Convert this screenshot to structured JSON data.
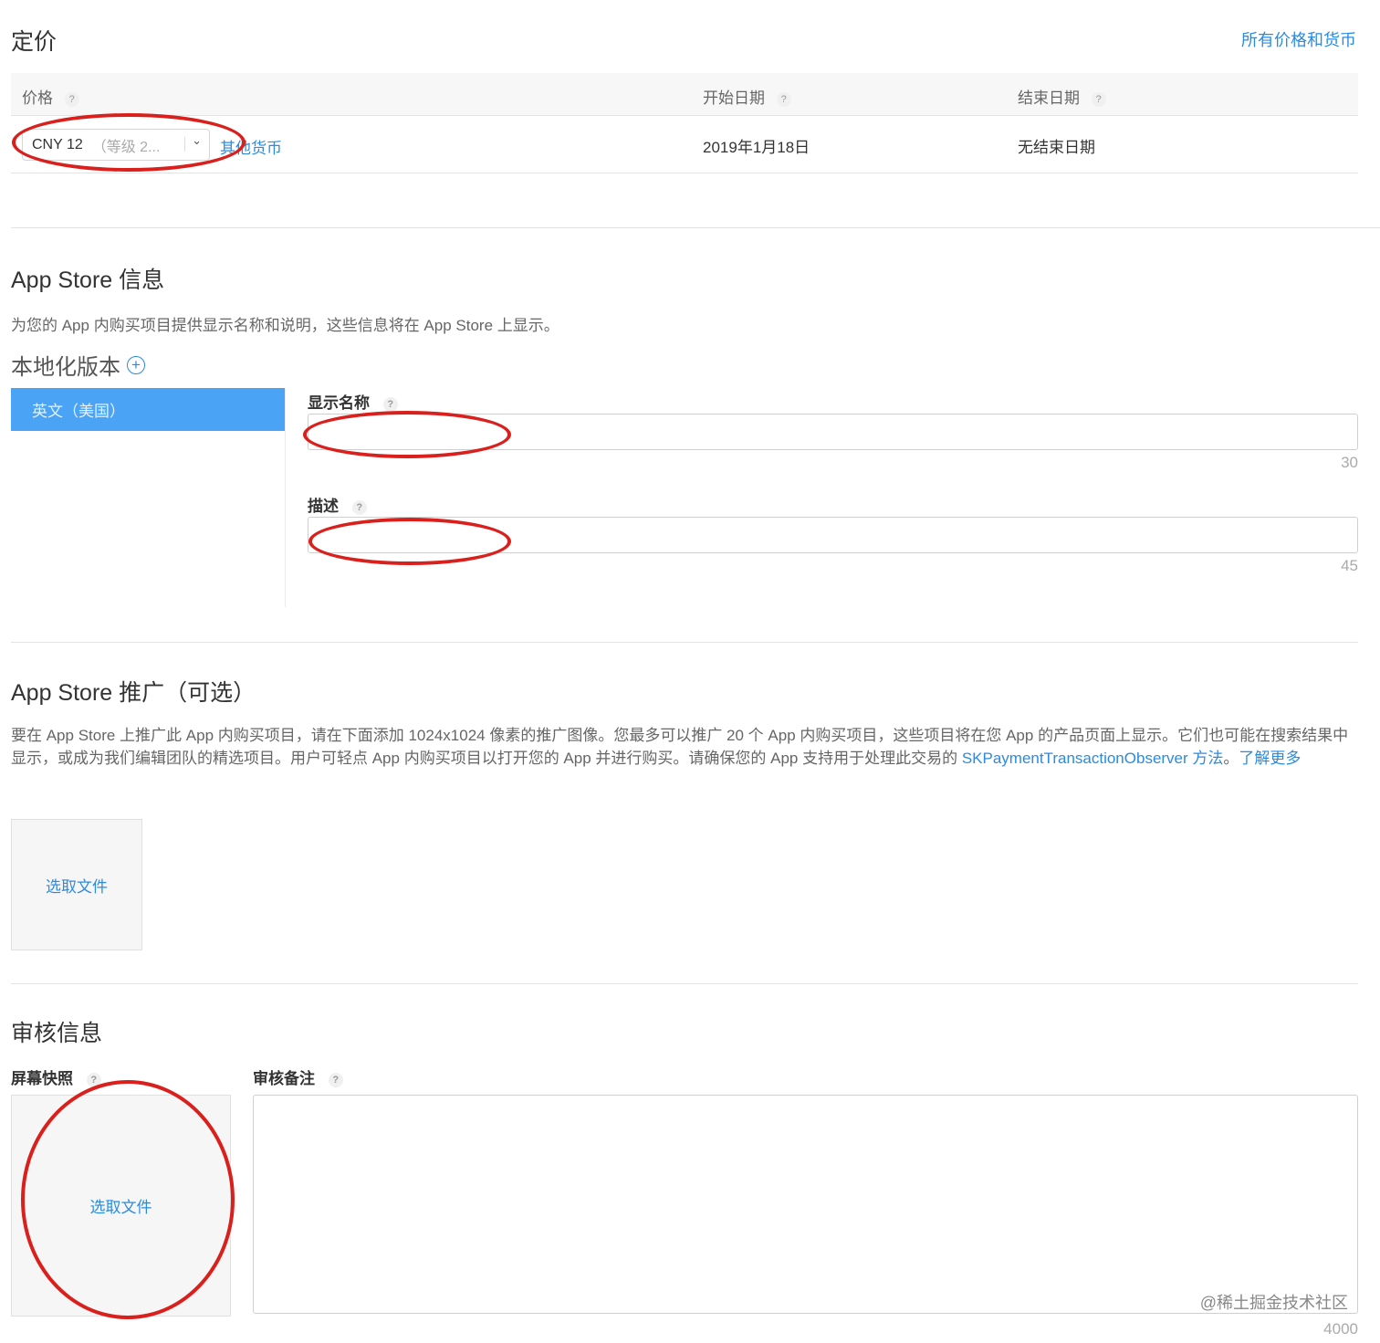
{
  "pricing": {
    "title": "定价",
    "all_prices_link": "所有价格和货币",
    "columns": {
      "price": "价格",
      "start_date": "开始日期",
      "end_date": "结束日期"
    },
    "help_mark": "?",
    "row": {
      "currency_value": "CNY 12",
      "tier_text": "（等级 2...",
      "other_currency_link": "其他货币",
      "start_date": "2019年1月18日",
      "end_date": "无结束日期"
    }
  },
  "store_info": {
    "title": "App Store 信息",
    "description": "为您的 App 内购买项目提供显示名称和说明，这些信息将在 App Store 上显示。",
    "localization_title": "本地化版本",
    "localizations": [
      "英文（美国）"
    ],
    "display_name_label": "显示名称",
    "display_name_value": "",
    "display_name_limit": "30",
    "description_label": "描述",
    "description_value": "",
    "description_limit": "45"
  },
  "promotion": {
    "title": "App Store 推广（可选）",
    "text_before": "要在 App Store 上推广此 App 内购买项目，请在下面添加 1024x1024 像素的推广图像。您最多可以推广 20 个 App 内购买项目，这些项目将在您 App 的产品页面上显示。它们也可能在搜索结果中显示，或成为我们编辑团队的精选项目。用户可轻点 App 内购买项目以打开您的 App 并进行购买。请确保您的 App 支持用于处理此交易的 ",
    "observer_link": "SKPaymentTransactionObserver 方法",
    "text_after": "。",
    "learn_more_link": "了解更多",
    "choose_file": "选取文件"
  },
  "review": {
    "title": "审核信息",
    "screenshot_label": "屏幕快照",
    "choose_file": "选取文件",
    "notes_label": "审核备注",
    "notes_value": "",
    "notes_limit": "4000"
  },
  "watermark": "@稀土掘金技术社区",
  "colors": {
    "accent": "#2b8be0",
    "selected_locale_bg": "#4aa3f5",
    "annotation_red": "#d9201d"
  }
}
